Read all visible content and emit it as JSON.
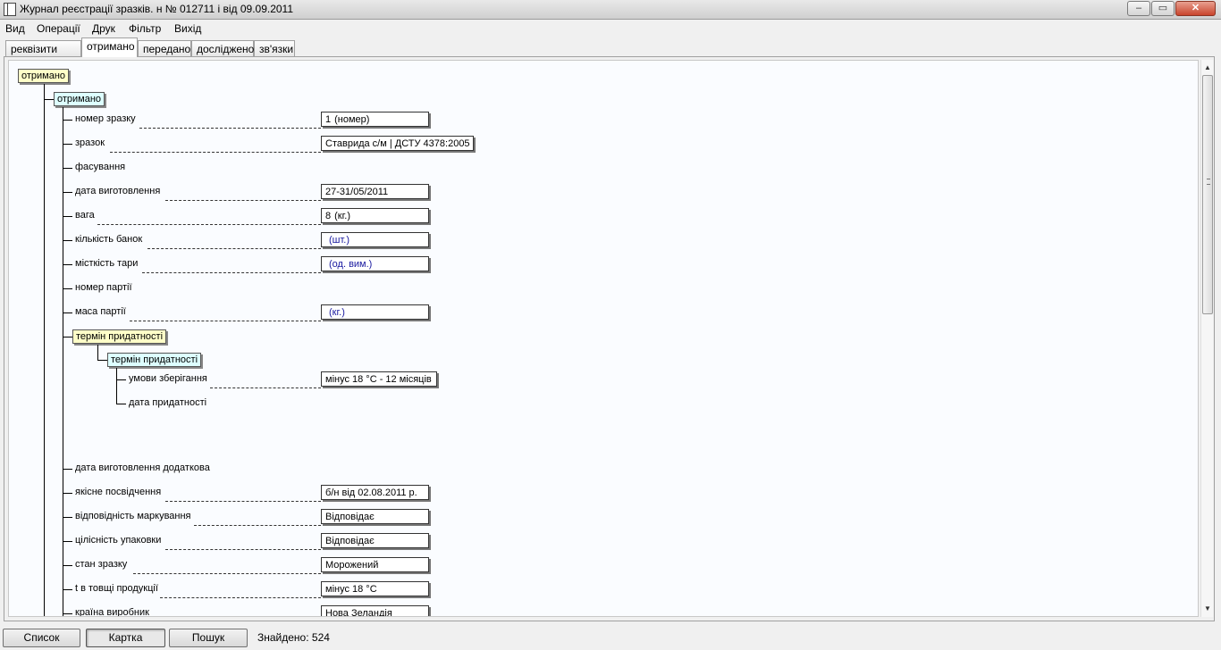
{
  "window": {
    "title": "Журнал реєстрації зразків. н № 012711 і від 09.09.2011",
    "controls": {
      "minimize": "‒",
      "maximize": "▭",
      "close": "✕"
    }
  },
  "menu": [
    "Вид",
    "Операції",
    "Друк",
    "Фільтр",
    "Вихід"
  ],
  "tabs": [
    {
      "label": "реквізити КЗП",
      "active": false
    },
    {
      "label": "отримано",
      "active": true
    },
    {
      "label": "передано",
      "active": false
    },
    {
      "label": "досліджено",
      "active": false
    },
    {
      "label": "зв'язки",
      "active": false
    }
  ],
  "tree": {
    "root": "отримано",
    "group": "отримано",
    "fields": [
      {
        "label": "номер зразку",
        "value": "1",
        "unit": "(номер)"
      },
      {
        "label": "зразок",
        "value": "Ставрида с/м | ДСТУ 4378:2005",
        "unit": ""
      },
      {
        "label": "фасування"
      },
      {
        "label": "дата виготовлення",
        "value": "27-31/05/2011",
        "unit": ""
      },
      {
        "label": "вага",
        "value": "8",
        "unit": "(кг.)"
      },
      {
        "label": "кількість банок",
        "value": "",
        "unit": "(шт.)"
      },
      {
        "label": "місткість тари",
        "value": "",
        "unit": "(од. вим.)"
      },
      {
        "label": "номер партії"
      },
      {
        "label": "маса партії",
        "value": "",
        "unit": "(кг.)"
      }
    ],
    "shelf_life_node": "термін придатності",
    "shelf_life_group": "термін придатності",
    "shelf_life_fields": [
      {
        "label": "умови зберігання",
        "value": "мінус 18 °С - 12 місяців",
        "unit": ""
      },
      {
        "label": "дата придатності"
      }
    ],
    "fields2": [
      {
        "label": "дата виготовлення додаткова"
      },
      {
        "label": "якісне посвідчення",
        "value": "б/н від 02.08.2011 р.",
        "unit": ""
      },
      {
        "label": "відповідність маркування",
        "value": "Відповідає",
        "unit": ""
      },
      {
        "label": "цілісність упаковки",
        "value": "Відповідає",
        "unit": ""
      },
      {
        "label": "стан зразку",
        "value": "Морожений",
        "unit": ""
      },
      {
        "label": "t в товщі продукції",
        "value": "мінус 18 °С",
        "unit": ""
      },
      {
        "label": "країна виробник",
        "value": "Нова Зеландія",
        "unit": ""
      }
    ]
  },
  "status": {
    "buttons": [
      "Список",
      "Картка",
      "Пошук"
    ],
    "found": "Знайдено: 524"
  }
}
